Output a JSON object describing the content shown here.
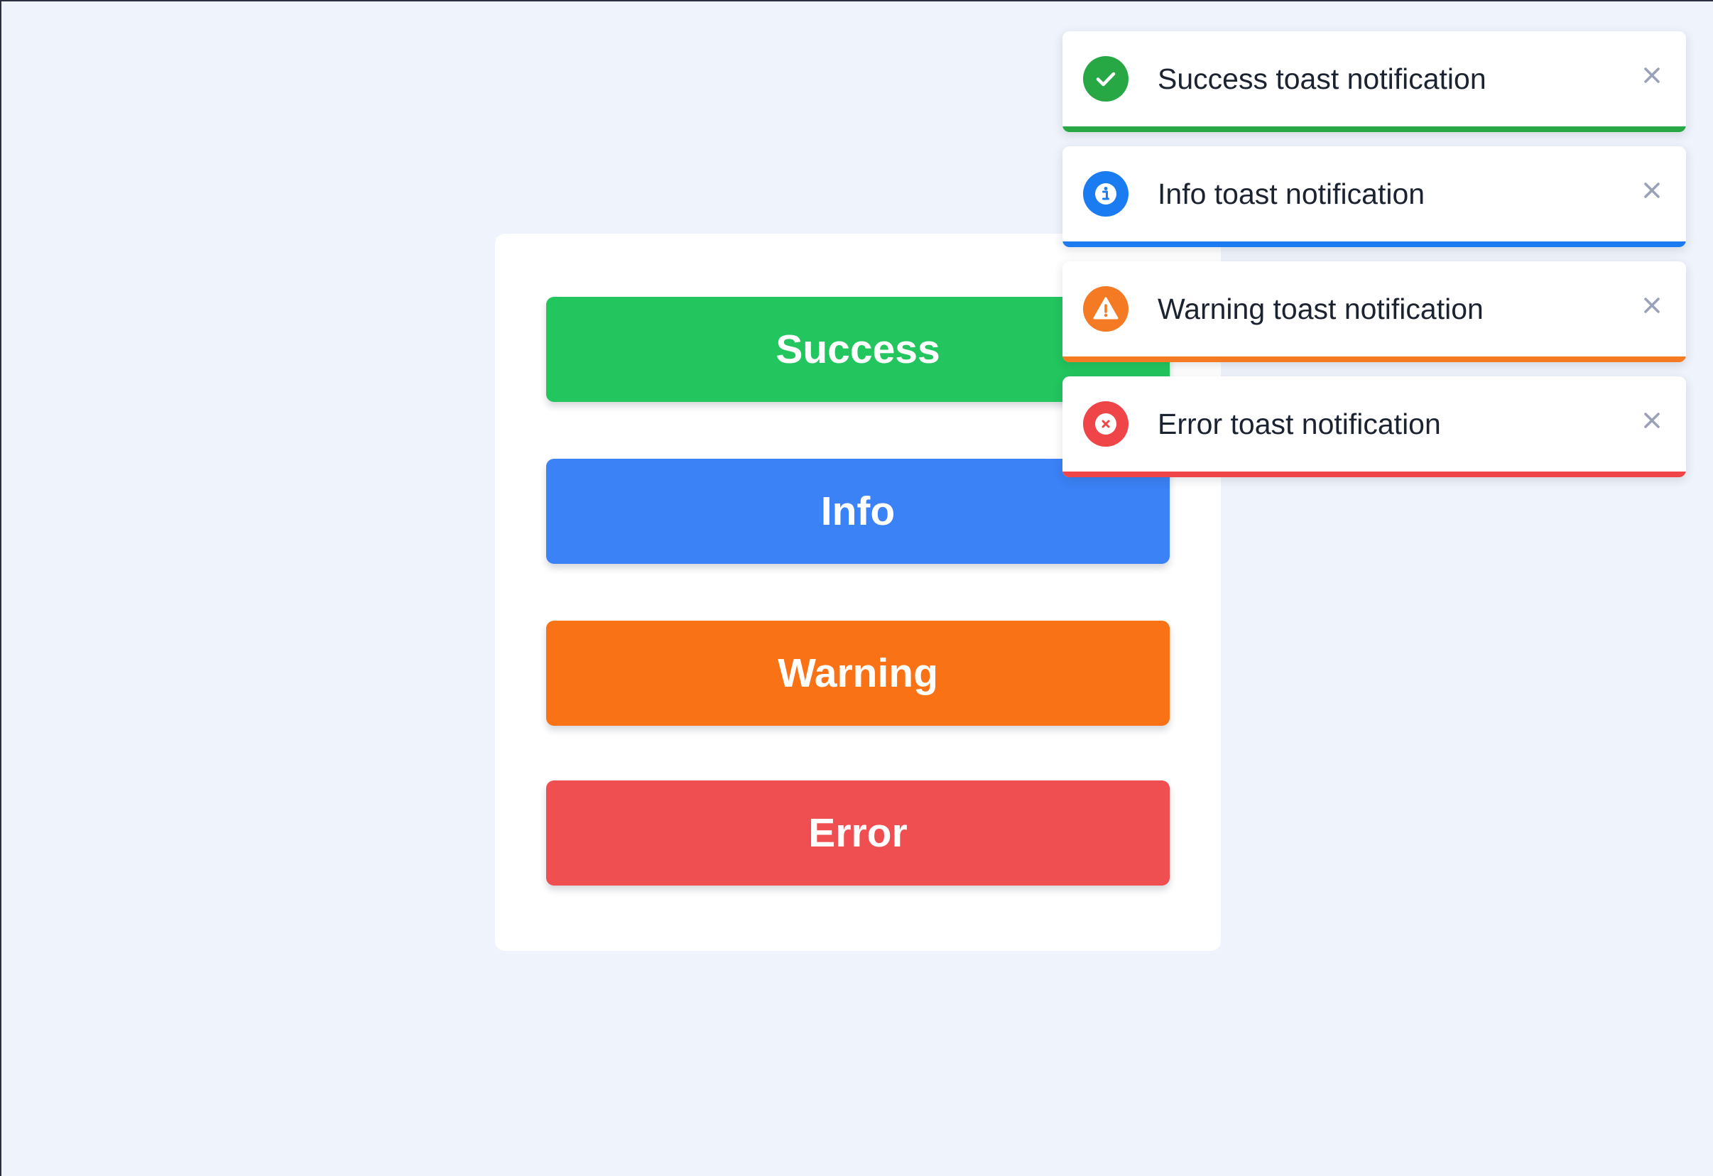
{
  "buttons": {
    "success_label": "Success",
    "info_label": "Info",
    "warning_label": "Warning",
    "error_label": "Error"
  },
  "toasts": [
    {
      "type": "success",
      "message": "Success toast notification",
      "icon": "check-circle-icon",
      "color": "#27a844"
    },
    {
      "type": "info",
      "message": "Info toast notification",
      "icon": "info-circle-icon",
      "color": "#1a7cf0"
    },
    {
      "type": "warning",
      "message": "Warning toast notification",
      "icon": "warning-triangle-icon",
      "color": "#f47a24"
    },
    {
      "type": "error",
      "message": "Error toast notification",
      "icon": "error-x-circle-icon",
      "color": "#ef4448"
    }
  ],
  "colors": {
    "background": "#eff3fb",
    "success_button": "#22c55e",
    "info_button": "#3b82f6",
    "warning_button": "#f97316",
    "error_button": "#ef4f51",
    "close_icon": "#9aa1b8"
  }
}
